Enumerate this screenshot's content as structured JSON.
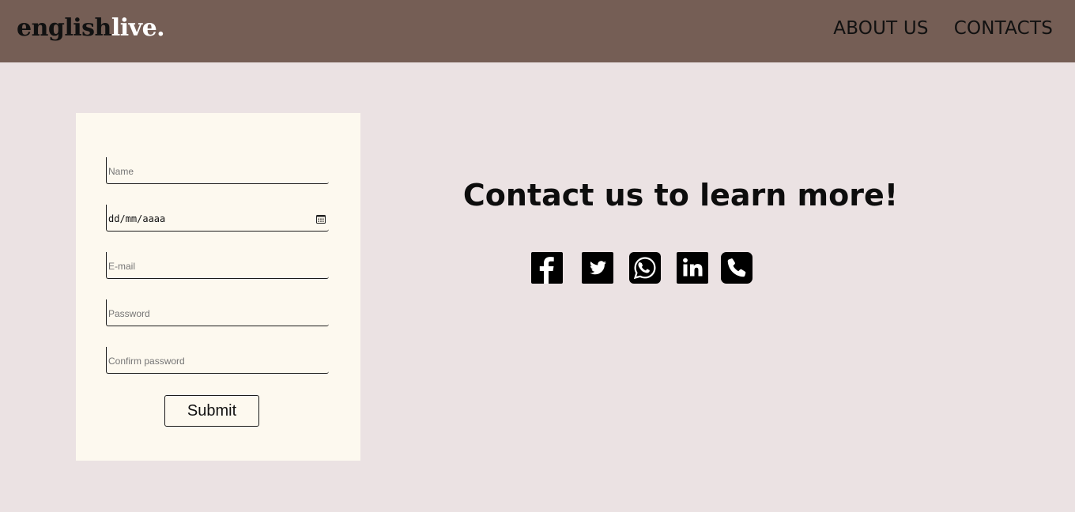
{
  "header": {
    "logo_part1": "english",
    "logo_part2": "live.",
    "nav": [
      {
        "label": "ABOUT US"
      },
      {
        "label": "CONTACTS"
      }
    ]
  },
  "form": {
    "name_placeholder": "Name",
    "date_value": "dd/mm/aaaa",
    "email_placeholder": "E-mail",
    "password_placeholder": "Password",
    "confirm_placeholder": "Confirm password",
    "submit_label": "Submit"
  },
  "contact": {
    "title": "Contact us to learn more!",
    "icons": [
      "facebook-icon",
      "twitter-icon",
      "whatsapp-icon",
      "linkedin-icon",
      "phone-icon"
    ]
  },
  "colors": {
    "header_bg": "#755e55",
    "page_bg": "#ebe2e3",
    "card_bg": "#fdf9ef"
  }
}
